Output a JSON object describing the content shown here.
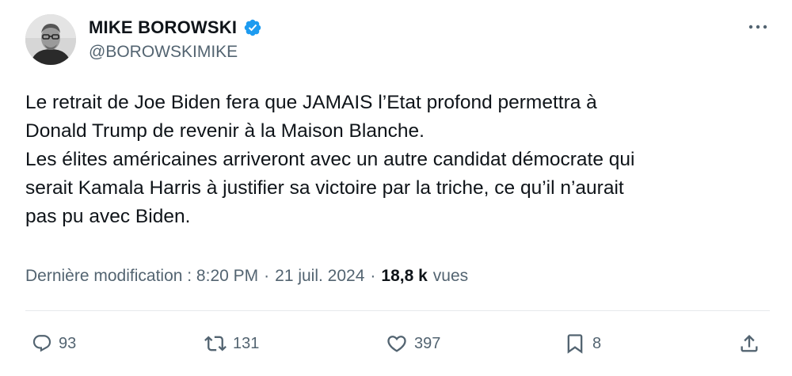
{
  "author": {
    "name": "MIKE BOROWSKI",
    "handle": "@BOROWSKIMIKE",
    "verified": true,
    "verified_color": "#1d9bf0"
  },
  "tweet": {
    "lines": [
      "Le retrait de Joe Biden fera que JAMAIS l’Etat profond permettra à",
      "Donald Trump de revenir à la Maison Blanche.",
      "Les élites américaines arriveront avec un autre candidat démocrate qui",
      "serait Kamala Harris à justifier sa victoire par la triche, ce qu’il n’aurait",
      "pas pu avec Biden."
    ]
  },
  "meta": {
    "modified_label": "Dernière modification : 8:20 PM",
    "date": "21 juil. 2024",
    "separator": "·",
    "views_count": "18,8 k",
    "views_label": "vues"
  },
  "actions": {
    "replies": "93",
    "retweets": "131",
    "likes": "397",
    "bookmarks": "8"
  },
  "icons": [
    "verified-badge-icon",
    "more-options-icon",
    "reply-icon",
    "retweet-icon",
    "like-icon",
    "bookmark-icon",
    "share-icon"
  ],
  "colors": {
    "text": "#0f1419",
    "secondary": "#536471",
    "divider": "#e6e9ec"
  }
}
